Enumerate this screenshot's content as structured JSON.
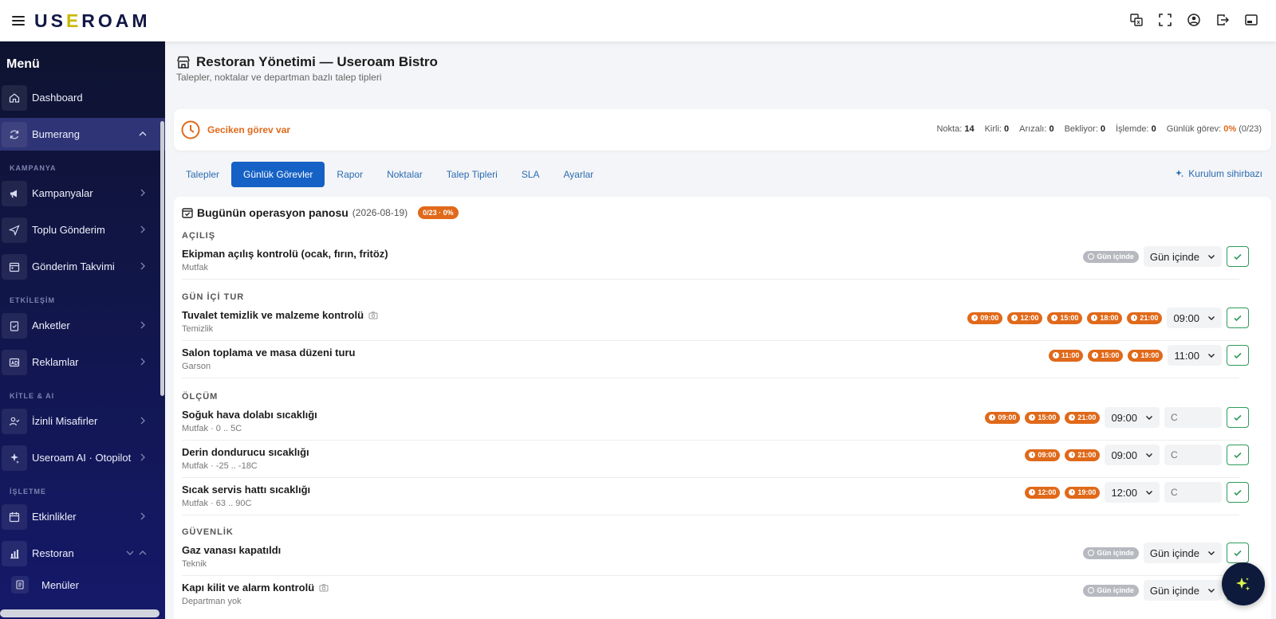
{
  "app": {
    "logo_left": "US",
    "logo_accent": "E",
    "logo_right": "ROAM"
  },
  "sidebar": {
    "menu_title": "Menü",
    "items_top": [
      {
        "label": "Dashboard",
        "icon": "home-icon"
      },
      {
        "label": "Bumerang",
        "icon": "refresh-icon"
      }
    ],
    "section_kampanya": "KAMPANYA",
    "items_kampanya": [
      {
        "label": "Kampanyalar",
        "icon": "megaphone-icon"
      },
      {
        "label": "Toplu Gönderim",
        "icon": "send-icon"
      },
      {
        "label": "Gönderim Takvimi",
        "icon": "calendar-icon"
      }
    ],
    "section_etkilesim": "ETKİLEŞİM",
    "items_etkilesim": [
      {
        "label": "Anketler",
        "icon": "clipboard-icon"
      },
      {
        "label": "Reklamlar",
        "icon": "ad-icon"
      }
    ],
    "section_kitle": "KİTLE & AI",
    "items_kitle": [
      {
        "label": "İzinli Misafirler",
        "icon": "user-check-icon"
      },
      {
        "label": "Useroam AI · Otopilot",
        "icon": "sparkle-icon"
      }
    ],
    "section_isletme": "İŞLETME",
    "items_isletme": [
      {
        "label": "Etkinlikler",
        "icon": "calendar-icon"
      },
      {
        "label": "Restoran",
        "icon": "chart-icon"
      }
    ],
    "sub_items": [
      {
        "label": "Menüler",
        "icon": "menu-doc-icon"
      }
    ]
  },
  "page": {
    "title": "Restoran Yönetimi — Useroam Bistro",
    "subtitle": "Talepler, noktalar ve departman bazlı talep tipleri"
  },
  "alert": {
    "text": "Geciken görev var",
    "stats": {
      "nokta_label": "Nokta:",
      "nokta": "14",
      "kirli_label": "Kirli:",
      "kirli": "0",
      "arizali_label": "Arızalı:",
      "arizali": "0",
      "bekliyor_label": "Bekliyor:",
      "bekliyor": "0",
      "islemde_label": "İşlemde:",
      "islemde": "0",
      "gunluk_label": "Günlük görev:",
      "gunluk_pct": "0%",
      "gunluk_count": "(0/23)"
    }
  },
  "tabs": [
    "Talepler",
    "Günlük Görevler",
    "Rapor",
    "Noktalar",
    "Talep Tipleri",
    "SLA",
    "Ayarlar"
  ],
  "wizard_label": "Kurulum sihirbazı",
  "board": {
    "title": "Bugünün operasyon panosu",
    "date": "(2026-08-19)",
    "badge": "0/23 · 0%",
    "sections": {
      "acilis": "AÇILIŞ",
      "gun_ici": "GÜN İÇİ TUR",
      "olcum": "ÖLÇÜM",
      "guvenlik": "GÜVENLİK"
    },
    "tasks": [
      {
        "name": "Ekipman açılış kontrolü (ocak, fırın, fritöz)",
        "dept": "Mutfak",
        "chip": "Gün içinde",
        "select": "Gün içinde"
      },
      {
        "name": "Tuvalet temizlik ve malzeme kontrolü",
        "dept": "Temizlik",
        "times": [
          "09:00",
          "12:00",
          "15:00",
          "18:00",
          "21:00"
        ],
        "select": "09:00"
      },
      {
        "name": "Salon toplama ve masa düzeni turu",
        "dept": "Garson",
        "times": [
          "11:00",
          "15:00",
          "19:00"
        ],
        "select": "11:00"
      },
      {
        "name": "Soğuk hava dolabı sıcaklığı",
        "dept": "Mutfak · 0 .. 5C",
        "times": [
          "09:00",
          "15:00",
          "21:00"
        ],
        "select": "09:00",
        "placeholder": "C"
      },
      {
        "name": "Derin dondurucu sıcaklığı",
        "dept": "Mutfak · -25 .. -18C",
        "times": [
          "09:00",
          "21:00"
        ],
        "select": "09:00",
        "placeholder": "C"
      },
      {
        "name": "Sıcak servis hattı sıcaklığı",
        "dept": "Mutfak · 63 .. 90C",
        "times": [
          "12:00",
          "19:00"
        ],
        "select": "12:00",
        "placeholder": "C"
      },
      {
        "name": "Gaz vanası kapatıldı",
        "dept": "Teknik",
        "chip": "Gün içinde",
        "select": "Gün içinde"
      },
      {
        "name": "Kapı kilit ve alarm kontrolü",
        "dept": "Departman yok",
        "chip": "Gün içinde",
        "select": "Gün içinde"
      }
    ]
  },
  "colors": {
    "accent": "#1561c5",
    "warning": "#e0691a",
    "success": "#2e9b5a",
    "sidebar": "#15196a"
  }
}
